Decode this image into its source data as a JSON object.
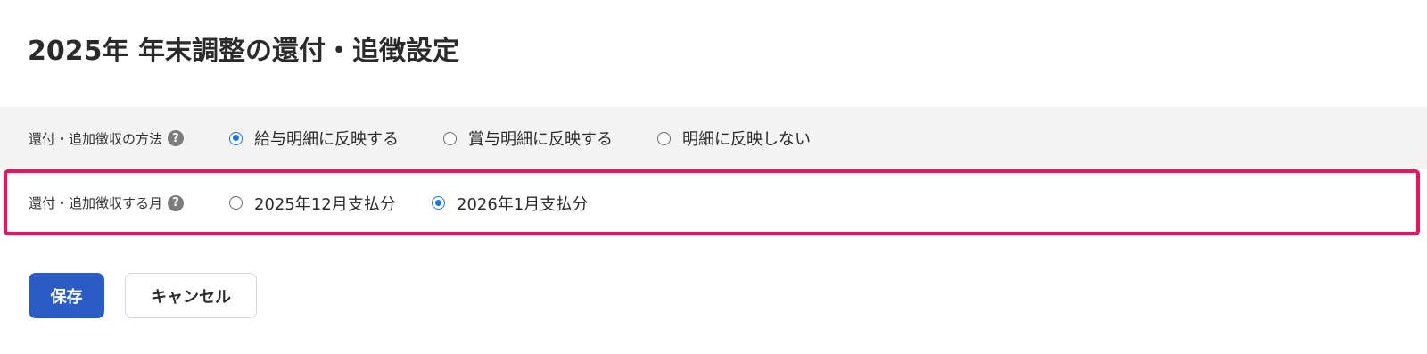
{
  "header": {
    "title": "2025年 年末調整の還付・追徴設定"
  },
  "settings": {
    "method": {
      "label": "還付・追加徴収の方法",
      "help_icon": "question-circle-icon",
      "options": [
        {
          "label": "給与明細に反映する",
          "checked": true
        },
        {
          "label": "賞与明細に反映する",
          "checked": false
        },
        {
          "label": "明細に反映しない",
          "checked": false
        }
      ]
    },
    "month": {
      "label": "還付・追加徴収する月",
      "help_icon": "question-circle-icon",
      "options": [
        {
          "label": "2025年12月支払分",
          "checked": false
        },
        {
          "label": "2026年1月支払分",
          "checked": true
        }
      ]
    }
  },
  "actions": {
    "save_label": "保存",
    "cancel_label": "キャンセル"
  },
  "colors": {
    "accent": "#1a73e8",
    "primary_button": "#2a5cc8",
    "highlight_border": "#f0125e",
    "section_background": "#f5f4f4"
  }
}
